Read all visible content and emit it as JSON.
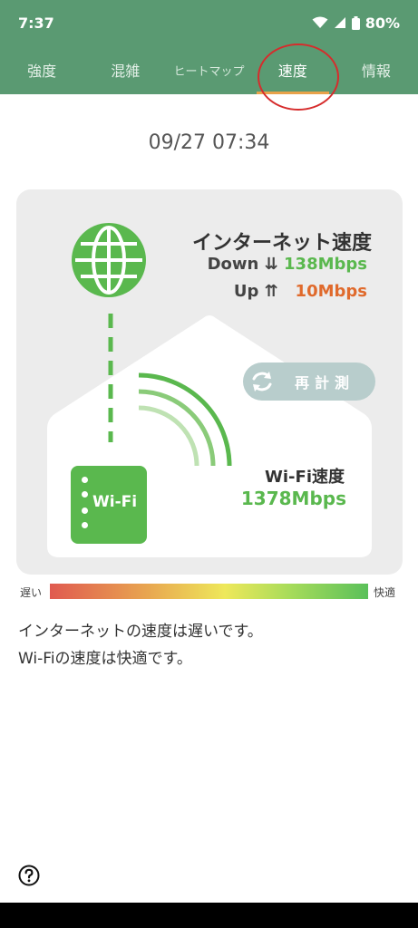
{
  "status_bar": {
    "time": "7:37",
    "battery": "80%"
  },
  "tabs": [
    {
      "label": "強度"
    },
    {
      "label": "混雑"
    },
    {
      "label": "ヒートマップ"
    },
    {
      "label": "速度"
    },
    {
      "label": "情報"
    }
  ],
  "measurement_datetime": "09/27 07:34",
  "internet": {
    "title": "インターネット速度",
    "down_label": "Down",
    "down_arrows": "⇊",
    "down_value": "138Mbps",
    "up_label": "Up",
    "up_arrows": "⇈",
    "up_value": "10Mbps"
  },
  "remeasure_label": "再計測",
  "router_label": "Wi-Fi",
  "wifi": {
    "title": "Wi-Fi速度",
    "value": "1378Mbps"
  },
  "scale": {
    "slow_label": "遅い",
    "fast_label": "快適"
  },
  "messages": {
    "internet": "インターネットの速度は遅いです。",
    "wifi": "Wi-Fiの速度は快適です。"
  },
  "colors": {
    "header": "#5a9a72",
    "tab_indicator": "#e8a24a",
    "green": "#5ab84e",
    "orange": "#e06a2c",
    "remeasure_button": "#b8cdcc"
  },
  "icons": {
    "status": [
      "wifi-icon",
      "signal-icon",
      "battery-icon"
    ],
    "globe": "globe-icon",
    "remeasure": "refresh-icon",
    "help": "help-icon"
  }
}
